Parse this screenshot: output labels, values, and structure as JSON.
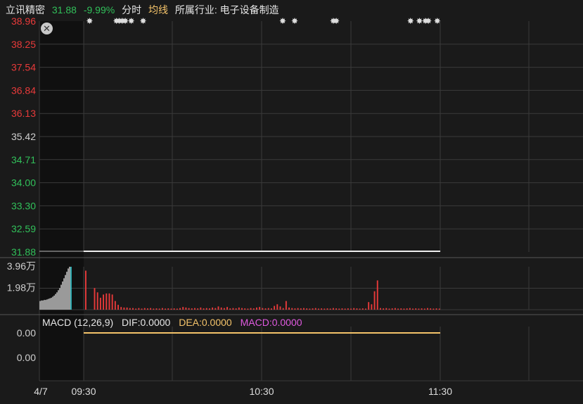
{
  "header": {
    "stock_name": "立讯精密",
    "price": "31.88",
    "change_pct": "-9.99%",
    "tab_fenshi": "分时",
    "tab_junxian": "均线",
    "industry": "所属行业: 电子设备制造"
  },
  "macd_legend": {
    "title": "MACD (12,26,9)",
    "dif": "DIF:0.0000",
    "dea": "DEA:0.0000",
    "macd": "MACD:0.0000"
  },
  "colors": {
    "background": "#1a1a1a",
    "grid": "#3a3a3a",
    "up": "#e83a3a",
    "down": "#31c05a",
    "neutral": "#cfcfcf",
    "avg_line": "#f4c36a",
    "macd_pink": "#e05ae0",
    "cursor": "#2fd1d8"
  },
  "chart_data": [
    {
      "type": "line",
      "panel": "price",
      "title": "",
      "y_ticks": [
        "38.96",
        "38.25",
        "37.54",
        "36.84",
        "36.13",
        "35.42",
        "34.71",
        "34.00",
        "33.30",
        "32.59",
        "31.88"
      ],
      "y_tick_colors": [
        "up",
        "up",
        "up",
        "up",
        "up",
        "neutral",
        "down",
        "down",
        "down",
        "down",
        "down"
      ],
      "ylim": [
        31.88,
        38.96
      ],
      "x_ticks": [
        "4/7",
        "09:30",
        "10:30",
        "11:30"
      ],
      "series": [
        {
          "x": [
            "09:30",
            "11:30"
          ],
          "values": [
            31.88,
            31.88
          ]
        }
      ],
      "event_markers_x": [
        "09:32",
        "09:41",
        "09:42",
        "09:43",
        "09:44",
        "09:46",
        "09:50",
        "10:37",
        "10:41",
        "10:54",
        "10:55",
        "11:20",
        "11:23",
        "11:25",
        "11:26",
        "11:29"
      ]
    },
    {
      "type": "bar",
      "panel": "volume",
      "y_ticks": [
        "3.96万",
        "1.98万"
      ],
      "ylim": [
        0,
        3.96
      ],
      "preopen_values": [
        0.8,
        0.85,
        0.85,
        0.9,
        0.9,
        0.95,
        1.0,
        1.05,
        1.1,
        1.2,
        1.3,
        1.45,
        1.6,
        1.8,
        2.0,
        2.3,
        2.6,
        2.9,
        3.2,
        3.5,
        3.8,
        3.96
      ],
      "session_values": [
        3.6,
        0,
        0,
        2.0,
        1.6,
        1.1,
        1.4,
        1.5,
        1.5,
        1.4,
        0.8,
        0.45,
        0.25,
        0.2,
        0.2,
        0.15,
        0.15,
        0.1,
        0.15,
        0.1,
        0.15,
        0.12,
        0.15,
        0.1,
        0.12,
        0.1,
        0.15,
        0.1,
        0.12,
        0.1,
        0.12,
        0.1,
        0.15,
        0.25,
        0.2,
        0.15,
        0.12,
        0.15,
        0.12,
        0.2,
        0.12,
        0.15,
        0.12,
        0.2,
        0.15,
        0.3,
        0.2,
        0.15,
        0.25,
        0.12,
        0.15,
        0.12,
        0.2,
        0.15,
        0.12,
        0.1,
        0.15,
        0.12,
        0.2,
        0.25,
        0.15,
        0.12,
        0.15,
        0.12,
        0.35,
        0.5,
        0.3,
        0.15,
        0.8,
        0.2,
        0.15,
        0.12,
        0.15,
        0.12,
        0.15,
        0.12,
        0.1,
        0.12,
        0.15,
        0.1,
        0.12,
        0.1,
        0.12,
        0.1,
        0.15,
        0.12,
        0.1,
        0.12,
        0.1,
        0.12,
        0.1,
        0.15,
        0.12,
        0.1,
        0.12,
        0.1,
        0.7,
        0.5,
        1.7,
        2.7,
        0.15,
        0.12,
        0.15,
        0.1,
        0.12,
        0.15,
        0.1,
        0.12,
        0.1,
        0.12,
        0.15,
        0.1,
        0.12,
        0.1,
        0.12,
        0.1,
        0.15,
        0.12,
        0.1,
        0.12,
        0.1
      ]
    },
    {
      "type": "line",
      "panel": "macd",
      "y_ticks": [
        "0.00",
        "0.00"
      ],
      "series": [
        {
          "name": "DEA",
          "x": [
            "09:30",
            "11:30"
          ],
          "values": [
            0,
            0
          ]
        }
      ]
    }
  ]
}
